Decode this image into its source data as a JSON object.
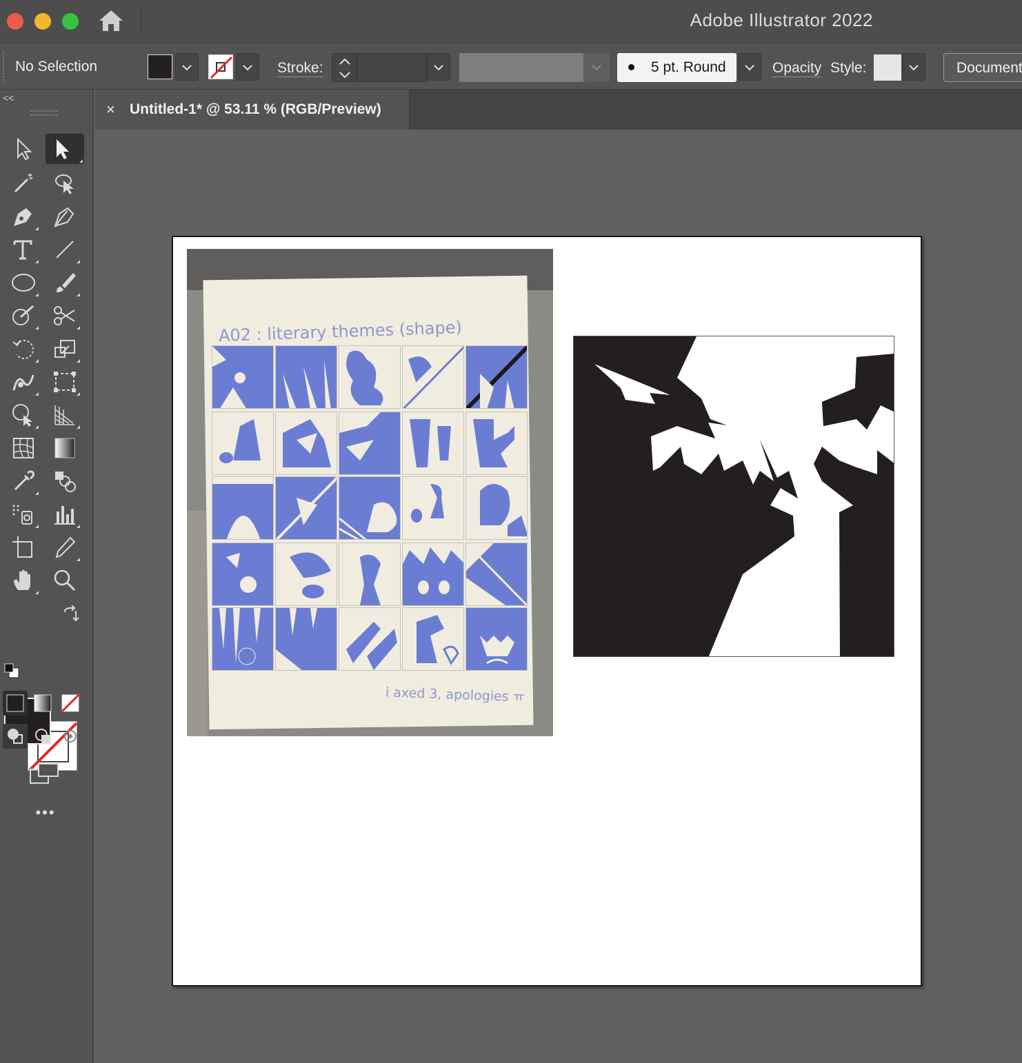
{
  "window": {
    "app_title": "Adobe Illustrator 2022"
  },
  "control_bar": {
    "selection_label": "No Selection",
    "stroke_label": "Stroke:",
    "stroke_weight": "",
    "brush_label": "5 pt. Round",
    "opacity_label": "Opacity",
    "style_label": "Style:",
    "document_button": "Document"
  },
  "document": {
    "tab_close": "×",
    "tab_title": "Untitled-1* @ 53.11 % (RGB/Preview)"
  },
  "artwork": {
    "photo_title": "A02 : literary themes (shape)",
    "photo_signature": "i axed 3, apologies ㅠ"
  },
  "toolbar": {
    "more_tools": "•••",
    "collapse": "<<"
  },
  "colors": {
    "fill": "#231f20",
    "stroke": "none",
    "thumb_blue": "#6b7dd3"
  }
}
